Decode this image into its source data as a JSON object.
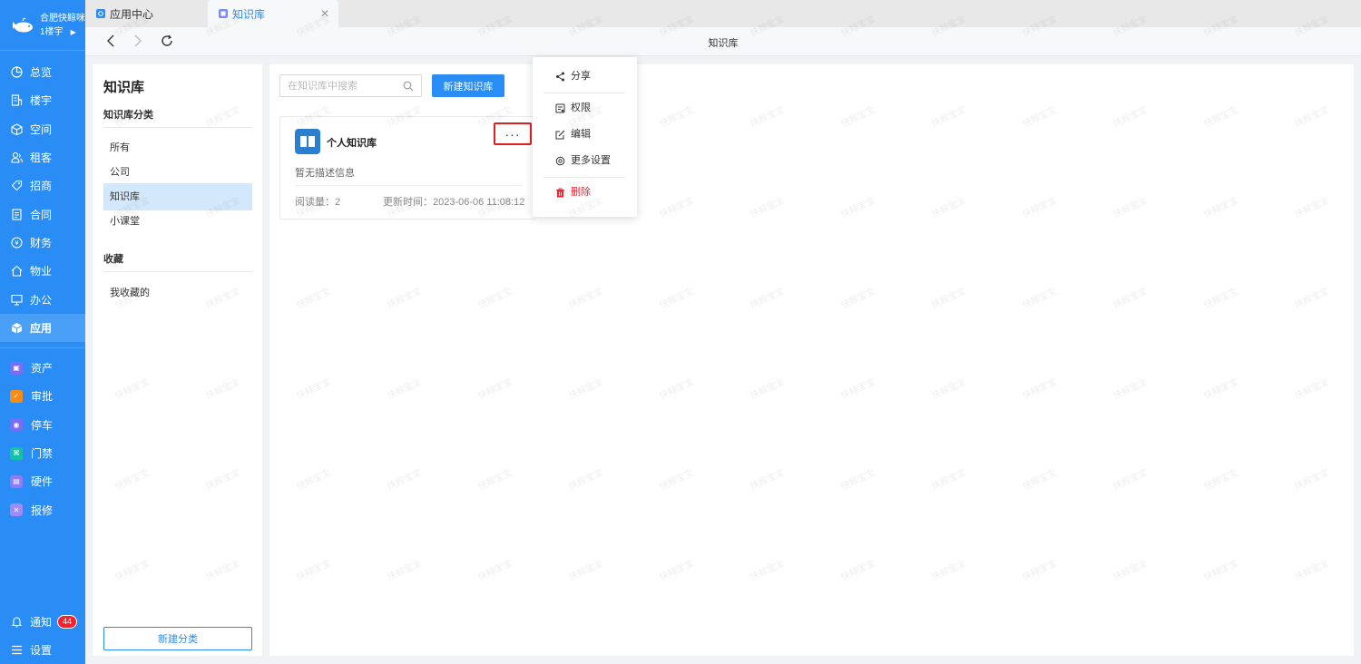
{
  "org": {
    "name": "合肥快鲸咪",
    "building": "1楼宇"
  },
  "nav": {
    "main": [
      {
        "label": "总览",
        "icon": "dashboard-icon"
      },
      {
        "label": "楼宇",
        "icon": "building-icon"
      },
      {
        "label": "空间",
        "icon": "space-icon"
      },
      {
        "label": "租客",
        "icon": "tenant-icon"
      },
      {
        "label": "招商",
        "icon": "tag-icon"
      },
      {
        "label": "合同",
        "icon": "contract-icon"
      },
      {
        "label": "财务",
        "icon": "finance-icon"
      },
      {
        "label": "物业",
        "icon": "home-icon"
      },
      {
        "label": "办公",
        "icon": "monitor-icon"
      },
      {
        "label": "应用",
        "icon": "app-cube-icon",
        "active": true
      }
    ],
    "apps": [
      {
        "label": "资产",
        "icon": "asset-icon",
        "color": "#7b6cf6"
      },
      {
        "label": "审批",
        "icon": "approval-icon",
        "color": "#fa8c16"
      },
      {
        "label": "停车",
        "icon": "parking-icon",
        "color": "#7b6cf6"
      },
      {
        "label": "门禁",
        "icon": "access-icon",
        "color": "#13c2a0"
      },
      {
        "label": "硬件",
        "icon": "hardware-icon",
        "color": "#8c7cf6"
      },
      {
        "label": "报修",
        "icon": "repair-icon",
        "color": "#9d8cf8"
      }
    ],
    "bottom": {
      "notify_label": "通知",
      "notify_count": "44",
      "settings_label": "设置"
    }
  },
  "tabs": [
    {
      "label": "应用中心",
      "icon": "app-center-icon"
    },
    {
      "label": "知识库",
      "icon": "knowledge-icon",
      "active": true
    }
  ],
  "toolbar": {
    "title": "知识库"
  },
  "categories": {
    "title": "知识库",
    "section_category": "知识库分类",
    "items": [
      "所有",
      "公司",
      "知识库",
      "小课堂"
    ],
    "active_index": 2,
    "section_favorites": "收藏",
    "favorite_items": [
      "我收藏的"
    ],
    "new_button": "新建分类"
  },
  "main": {
    "search_placeholder": "在知识库中搜索",
    "new_button": "新建知识库",
    "card": {
      "name": "个人知识库",
      "more": "···",
      "description": "暂无描述信息",
      "reads": "阅读量：2",
      "updated": "更新时间：2023-06-06 11:08:12"
    }
  },
  "menu": {
    "items": [
      {
        "label": "分享",
        "icon": "share-icon"
      },
      {
        "label": "权限",
        "icon": "permission-icon"
      },
      {
        "label": "编辑",
        "icon": "edit-icon"
      },
      {
        "label": "更多设置",
        "icon": "gear-icon"
      },
      {
        "label": "删除",
        "icon": "trash-icon"
      }
    ]
  },
  "watermark_text": "快鲸宝宝",
  "colors": {
    "brand": "#2a8cf5",
    "danger": "#f5222d",
    "active_bg": "#d4e8fc"
  }
}
